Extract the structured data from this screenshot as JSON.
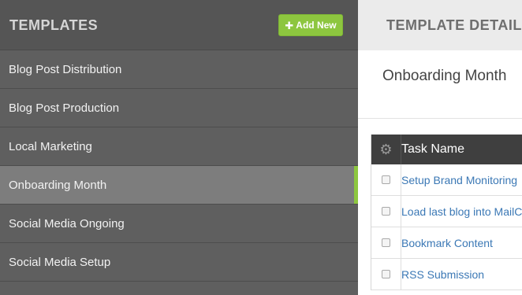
{
  "sidebar": {
    "title": "TEMPLATES",
    "add_button": "Add New",
    "items": [
      {
        "label": "Blog Post Distribution"
      },
      {
        "label": "Blog Post Production"
      },
      {
        "label": "Local Marketing"
      },
      {
        "label": "Onboarding Month",
        "active": true
      },
      {
        "label": "Social Media Ongoing"
      },
      {
        "label": "Social Media Setup"
      }
    ]
  },
  "details": {
    "title": "TEMPLATE DETAILS",
    "template_name": "Onboarding Month",
    "table": {
      "header": "Task Name",
      "rows": [
        {
          "task": "Setup Brand Monitoring"
        },
        {
          "task": "Load last blog into MailChimp"
        },
        {
          "task": "Bookmark Content"
        },
        {
          "task": "RSS Submission"
        }
      ]
    }
  },
  "icons": {
    "add": "plus-icon",
    "table_settings": "gear-icon"
  },
  "colors": {
    "accent": "#8dc63f",
    "sidebar_bg": "#5f5f5f",
    "active_item_bg": "#7d7d7d",
    "link": "#3b78b5",
    "table_header_bg": "#3f3f3f"
  }
}
